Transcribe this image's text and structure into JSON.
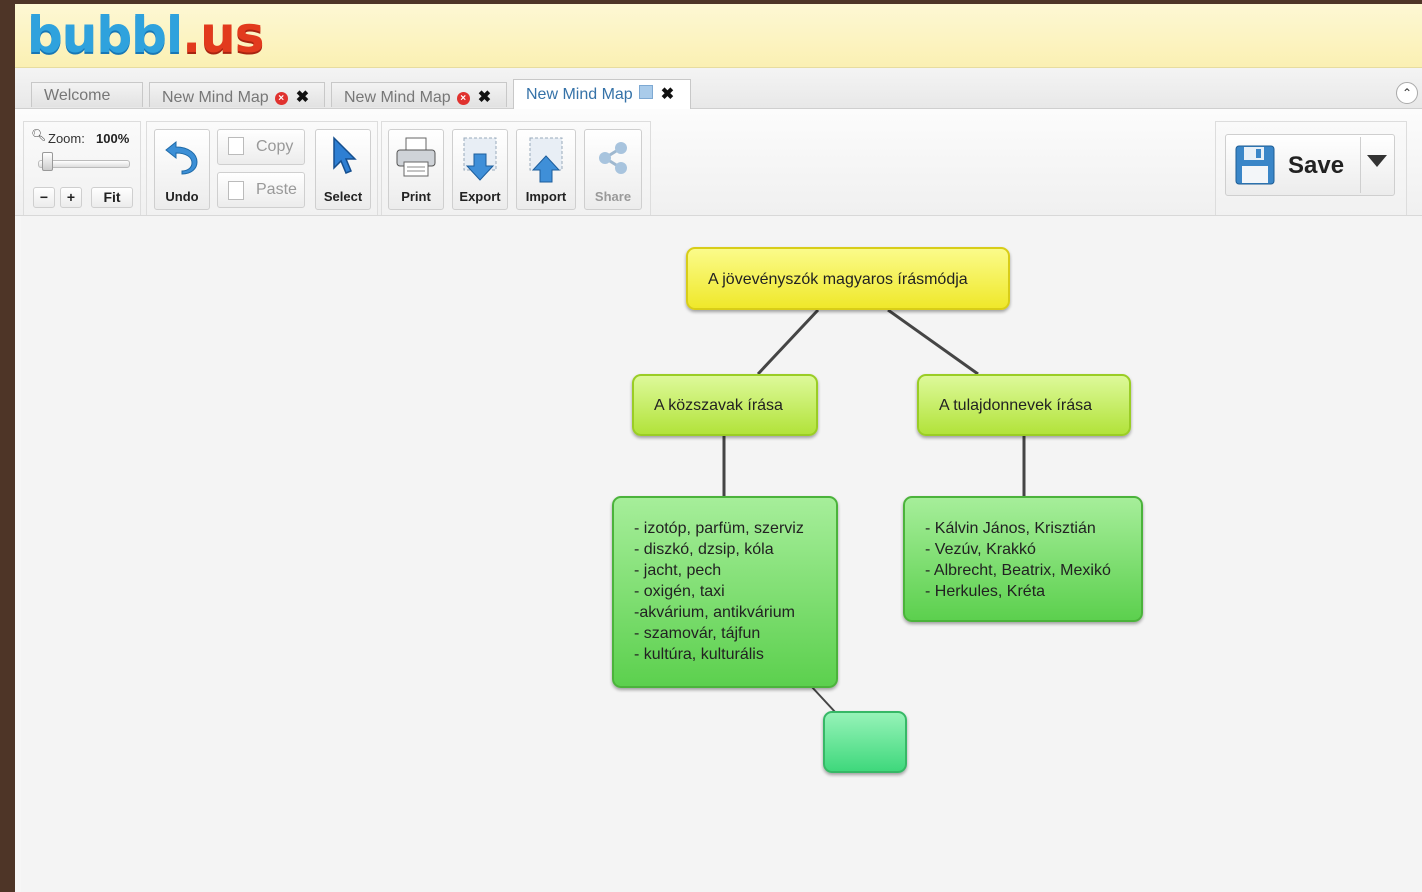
{
  "app": {
    "logo_part1": "bubbl",
    "logo_part2": ".us"
  },
  "tabs": [
    {
      "label": "Welcome",
      "active": false
    },
    {
      "label": "New Mind Map",
      "active": false
    },
    {
      "label": "New Mind Map",
      "active": false
    },
    {
      "label": "New Mind Map",
      "active": true
    }
  ],
  "toolbar": {
    "zoom_label": "Zoom:",
    "zoom_value": "100%",
    "zoom_minus": "−",
    "zoom_plus": "+",
    "fit_label": "Fit",
    "undo_label": "Undo",
    "copy_label": "Copy",
    "paste_label": "Paste",
    "select_label": "Select",
    "print_label": "Print",
    "export_label": "Export",
    "import_label": "Import",
    "share_label": "Share",
    "save_label": "Save"
  },
  "mindmap": {
    "root": "A jövevényszók magyaros írásmódja",
    "left_branch": "A közszavak írása",
    "right_branch": "A tulajdonnevek írása",
    "left_leaf": [
      "- izotóp, parfüm, szerviz",
      "- diszkó, dzsip, kóla",
      "- jacht, pech",
      "- oxigén, taxi",
      "-akvárium, antikvárium",
      "- szamovár, tájfun",
      "- kultúra, kulturális"
    ],
    "right_leaf": [
      "- Kálvin János, Krisztián",
      "- Vezúv, Krakkó",
      "- Albrecht, Beatrix, Mexikó",
      "- Herkules, Kréta"
    ],
    "empty_node": ""
  },
  "colors": {
    "frame": "#4e3527",
    "root_node": "#f4ee3c",
    "branch_node": "#c4ec55",
    "leaf_node": "#6cd65c",
    "new_node": "#4fe08c",
    "active_tab_text": "#3572a8"
  }
}
